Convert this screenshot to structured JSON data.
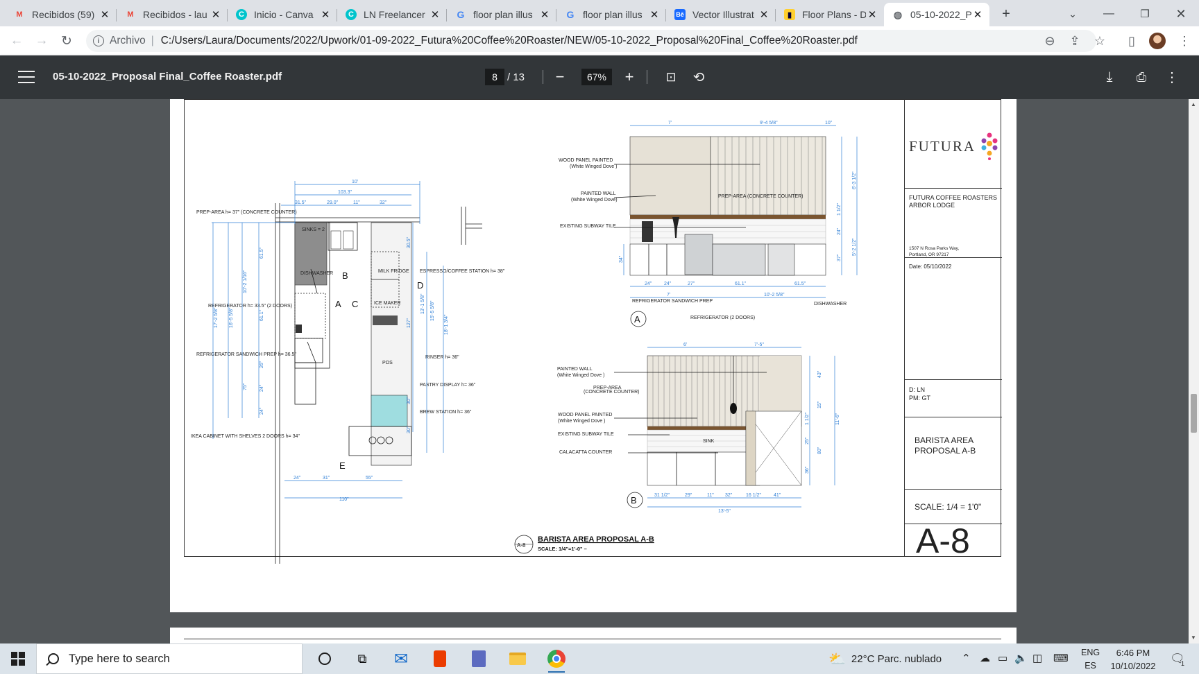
{
  "browser": {
    "tabs": [
      {
        "title": "Recibidos (59)",
        "icon": "gmail-icon",
        "color": "#ea4335"
      },
      {
        "title": "Recibidos - lau",
        "icon": "gmail-icon",
        "color": "#ea4335"
      },
      {
        "title": "Inicio - Canva",
        "icon": "canva-icon",
        "color": "#00c4cc"
      },
      {
        "title": "LN Freelancer",
        "icon": "canva-icon",
        "color": "#00c4cc"
      },
      {
        "title": "floor plan illus",
        "icon": "google-icon",
        "color": "#4285f4"
      },
      {
        "title": "floor plan illus",
        "icon": "google-icon",
        "color": "#4285f4"
      },
      {
        "title": "Vector Illustrat",
        "icon": "behance-icon",
        "color": "#1769ff"
      },
      {
        "title": "Floor Plans - D",
        "icon": "miro-icon",
        "color": "#ffd02f"
      },
      {
        "title": "05-10-2022_P",
        "icon": "globe-icon",
        "color": "#5f6368"
      }
    ],
    "new_tab": "+",
    "address": {
      "scheme": "Archivo",
      "url": "C:/Users/Laura/Documents/2022/Upwork/01-09-2022_Futura%20Coffee%20Roaster/NEW/05-10-2022_Proposal%20Final_Coffee%20Roaster.pdf"
    }
  },
  "pdf_viewer": {
    "title": "05-10-2022_Proposal Final_Coffee Roaster.pdf",
    "current_page": "8",
    "total_pages": "/ 13",
    "zoom": "67%"
  },
  "drawing": {
    "plan": {
      "markers": {
        "a": "A",
        "b": "B",
        "c": "C",
        "d": "D",
        "e": "E"
      },
      "labels": {
        "prep_area": "PREP-AREA h= 37\" (CONCRETE COUNTER)",
        "sinks": "SINKS = 2",
        "dishwasher": "DISHWASHER",
        "milk_fridge": "MILK FRIDGE",
        "espresso": "ESPRESSO/COFFEE STATION  h= 38\"",
        "ice_maker": "ICE MAKER",
        "refrigerator": "REFRIGERATOR  h= 33.5\" (2 DOORS)",
        "pos": "POS",
        "rinser": "RINSER h= 36\"",
        "sandwich_prep": "REFRIGERATOR SANDWICH PREP h= 36.5\"",
        "pastry": "PASTRY DISPLAY  h= 36\"",
        "brew": "BREW STATION  h= 36\"",
        "ikea": "IKEA CABINET WITH SHELVES 2 DOORS h= 34\""
      },
      "dims": {
        "top_10": "10'",
        "w_103": "103.3\"",
        "w_31": "31.5\"",
        "w_29": "29.0\"",
        "w_11": "11\"",
        "w_32": "32\"",
        "bot_24": "24\"",
        "bot_31": "31\"",
        "bot_55": "55\"",
        "bot_110": "110\"",
        "v_615": "61.5\"",
        "v_10": "10'-2 1/16\"",
        "v_16": "16'-5 5/8\"",
        "v_17": "17'-2 5/8\"",
        "v_611": "61.1\"",
        "v_26": "26\"",
        "v_75": "75\"",
        "v_24a": "24\"",
        "v_24b": "24\"",
        "v_305": "30.5\"",
        "v_13": "13'-1 5/8\"",
        "v_15": "15'-5 5/8\"",
        "v_18": "18'-1 3/4\"",
        "v_127": "127\"",
        "v_30a": "30\"",
        "v_30b": "30\""
      }
    },
    "elev_a": {
      "marker": "A",
      "labels": {
        "wood_panel": "WOOD PANEL PAINTED",
        "wood_panel_sub": "(White Winged Dove )",
        "painted_wall": "PAINTED WALL",
        "painted_wall_sub": "(White Winged Dove)",
        "subway": "EXISTING SUBWAY TILE",
        "prep": "PREP-AREA (CONCRETE COUNTER)",
        "sandwich": "REFRIGERATOR SANDWICH PREP",
        "fridge": "REFRIGERATOR (2 DOORS)",
        "dishwasher": "DISHWASHER"
      },
      "dims": {
        "w7": "7'",
        "w9": "9'-4 5/8\"",
        "w10": "10\"",
        "h63": "6'-3 1/2\"",
        "h52": "5'-2 1/2\"",
        "h15": "1 1/2\"",
        "h24": "24\"",
        "h37": "37\"",
        "h34": "34\"",
        "b24a": "24\"",
        "b24b": "24\"",
        "b27": "27\"",
        "b611": "61.1\"",
        "b615": "61.5\"",
        "b7": "7'",
        "b10": "10'-2 5/8\""
      }
    },
    "elev_b": {
      "marker": "B",
      "labels": {
        "painted_wall": "PAINTED WALL",
        "painted_wall_sub": "(White Winged Dove )",
        "prep": "PREP-AREA",
        "prep_sub": "(CONCRETE COUNTER)",
        "wood_panel": "WOOD PANEL PAINTED",
        "wood_panel_sub": "(White Winged Dove )",
        "subway": "EXISTING SUBWAY TILE",
        "calacatta": "CALACATTA COUNTER",
        "sink": "SINK"
      },
      "dims": {
        "t6": "6'",
        "t7": "7'-5\"",
        "h43": "43\"",
        "h15": "15\"",
        "h15b": "1 1/2\"",
        "h25": "25\"",
        "h80": "80\"",
        "h36": "36\"",
        "h116": "11'-6\"",
        "b31": "31 1/2\"",
        "b29": "29\"",
        "b11": "11\"",
        "b32": "32\"",
        "b16": "16 1/2\"",
        "b41": "41\"",
        "b135": "13'-5\""
      }
    },
    "caption": {
      "tag": "A-8",
      "title": "BARISTA AREA PROPOSAL A-B",
      "scale": "SCALE:  1/4\"=1'-0\"  –"
    }
  },
  "title_block": {
    "brand": "FUTURA",
    "client_line1": "FUTURA COFFEE ROASTERS",
    "client_line2": "ARBOR LODGE",
    "address1": "1507 N Rosa Parks Way,",
    "address2": "Portland, OR 97217",
    "date": "Date: 05/10/2022",
    "designer": "D: LN",
    "pm": "PM: GT",
    "sheet_title1": "BARISTA AREA",
    "sheet_title2": "PROPOSAL A-B",
    "scale": "SCALE: 1/4 = 1'0\"",
    "sheet_number": "A-8",
    "logo_colors": [
      "#e8337f",
      "#f5a623",
      "#8e44ad",
      "#3fb0e0"
    ]
  },
  "taskbar": {
    "search_placeholder": "Type here to search",
    "weather": "22°C  Parc. nublado",
    "lang1": "ENG",
    "lang2": "ES",
    "time": "6:46 PM",
    "date": "10/10/2022",
    "notifications": "1"
  }
}
